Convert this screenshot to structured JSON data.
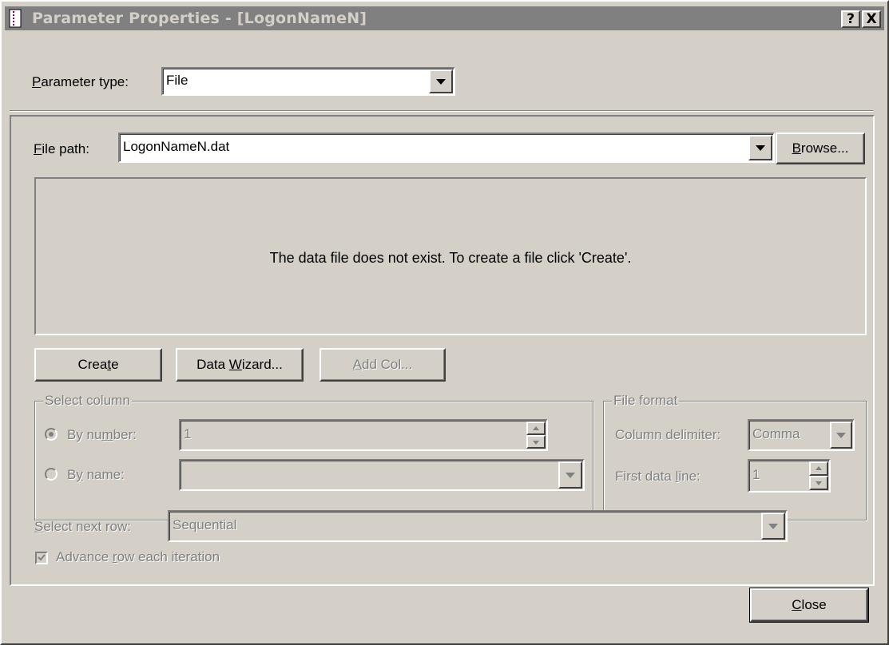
{
  "window": {
    "title": "Parameter Properties - [LogonNameN]",
    "help_label": "?",
    "close_label": "X"
  },
  "parameter_type": {
    "label_prefix": "",
    "label_accel": "P",
    "label_rest": "arameter type:",
    "value": "File"
  },
  "file_path": {
    "label_accel": "F",
    "label_rest": "ile path:",
    "value": "LogonNameN.dat",
    "browse_accel": "B",
    "browse_rest": "rowse..."
  },
  "data_area": {
    "message": "The data file does not exist. To create a file click 'Create'."
  },
  "actions": {
    "create_pre": "Crea",
    "create_accel": "t",
    "create_post": "e",
    "wizard_pre": "Data ",
    "wizard_accel": "W",
    "wizard_post": "izard...",
    "addcol_pre": "",
    "addcol_accel": "A",
    "addcol_post": "dd Col..."
  },
  "select_column": {
    "title": "Select column",
    "by_number_pre": "By nu",
    "by_number_accel": "m",
    "by_number_post": "ber:",
    "by_number_value": "1",
    "by_name_pre": "B",
    "by_name_accel": "y",
    "by_name_post": " name:",
    "by_name_value": "",
    "selected": "by_number"
  },
  "file_format": {
    "title": "File format",
    "delimiter_label": "Column delimiter:",
    "delimiter_value": "Comma",
    "first_line_pre": "First data ",
    "first_line_accel": "l",
    "first_line_post": "ine:",
    "first_line_value": "1"
  },
  "next_row": {
    "label_accel": "S",
    "label_rest": "elect next row:",
    "value": "Sequential"
  },
  "advance": {
    "label_pre": "Advance ",
    "label_accel": "r",
    "label_post": "ow each iteration",
    "checked": true
  },
  "footer": {
    "close_accel": "C",
    "close_rest": "lose"
  },
  "colors": {
    "face": "#d4d0c8",
    "titlebar_inactive": "#808080",
    "disabled_text": "#808080"
  }
}
